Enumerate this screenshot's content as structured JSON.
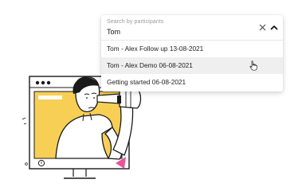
{
  "search": {
    "label": "Search by participants",
    "value": "Tom"
  },
  "icons": {
    "clear": "close-icon",
    "toggle": "chevron-up-icon",
    "pointer": "hand-cursor-icon"
  },
  "results": [
    {
      "label": "Tom - Alex Follow up 13-08-2021",
      "highlighted": false
    },
    {
      "label": "Tom - Alex Demo 06-08-2021",
      "highlighted": true
    },
    {
      "label": "Getting started 06-08-2021",
      "highlighted": false
    }
  ],
  "colors": {
    "accent_yellow": "#F8CF55",
    "accent_pink": "#E8549A",
    "line": "#1A1A1A",
    "highlight_row": "#EFEFEF"
  }
}
